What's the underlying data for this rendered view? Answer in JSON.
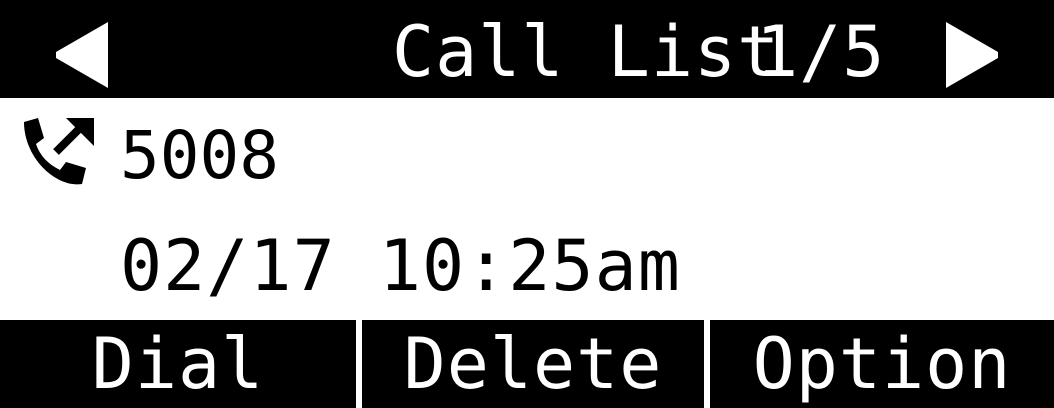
{
  "header": {
    "title": "Call List",
    "page_indicator": "1/5",
    "prev_icon": "arrow-left-icon",
    "next_icon": "arrow-right-icon"
  },
  "entry": {
    "icon": "outgoing-call-icon",
    "number": "5008",
    "datetime": "02/17 10:25am"
  },
  "softkeys": [
    {
      "label": "Dial"
    },
    {
      "label": "Delete"
    },
    {
      "label": "Option"
    }
  ],
  "colors": {
    "background": "#ffffff",
    "bar": "#000000",
    "bar_text": "#ffffff",
    "text": "#000000"
  }
}
